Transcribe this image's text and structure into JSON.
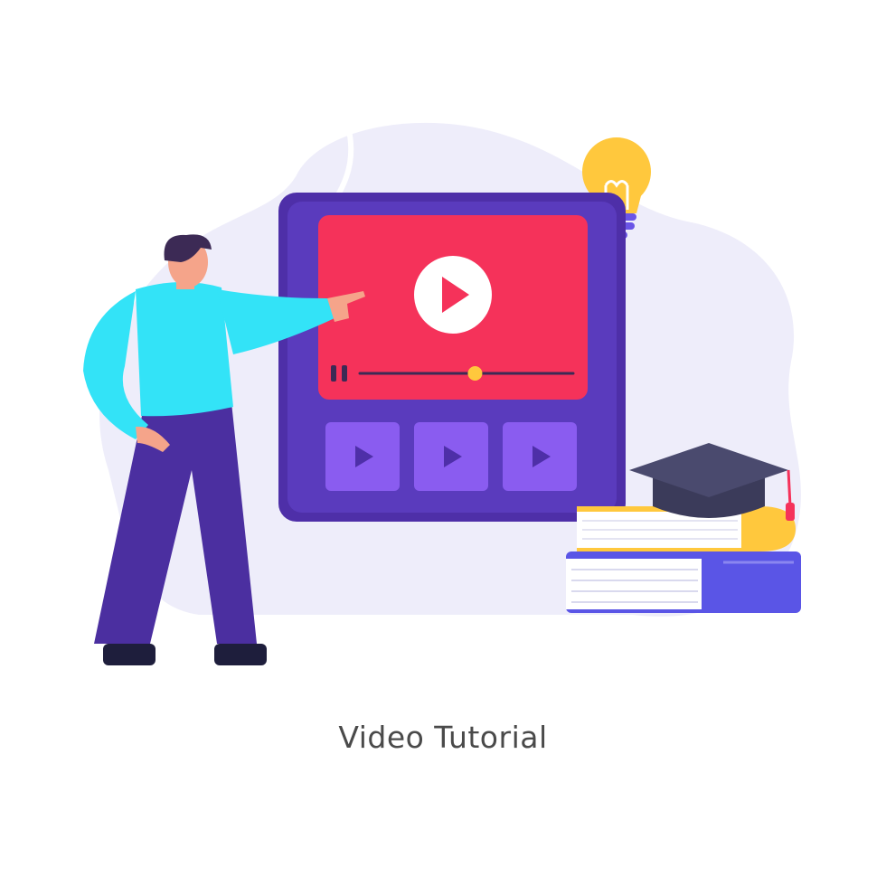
{
  "caption": "Video Tutorial",
  "colors": {
    "background_blob": "#eeedfa",
    "tablet_frame": "#4e2fa8",
    "video_screen": "#f5325a",
    "play_circle": "#ffffff",
    "play_triangle": "#f5325a",
    "progress_knob": "#ffc83d",
    "thumbnail_tile": "#8a5cf0",
    "thumbnail_play": "#4e2fa8",
    "bulb": "#ffc83d",
    "bulb_base": "#6a55e6",
    "shirt": "#33e3f7",
    "trousers": "#4b2fa0",
    "hair": "#3c2a55",
    "skin": "#f5a48a",
    "shoes": "#1e1e3c",
    "book_top_cover": "#ffc83d",
    "book_bottom_cover": "#5a55e6",
    "grad_cap": "#3b3b5a",
    "tassel": "#f5325a"
  },
  "icons": {
    "main_play": "play-icon",
    "pause": "pause-icon",
    "thumbnail_play": "play-icon",
    "bulb": "lightbulb-icon",
    "cap": "graduation-cap-icon",
    "books": "books-icon"
  },
  "player": {
    "progress_fraction": 0.54,
    "thumbnail_count": 3
  }
}
